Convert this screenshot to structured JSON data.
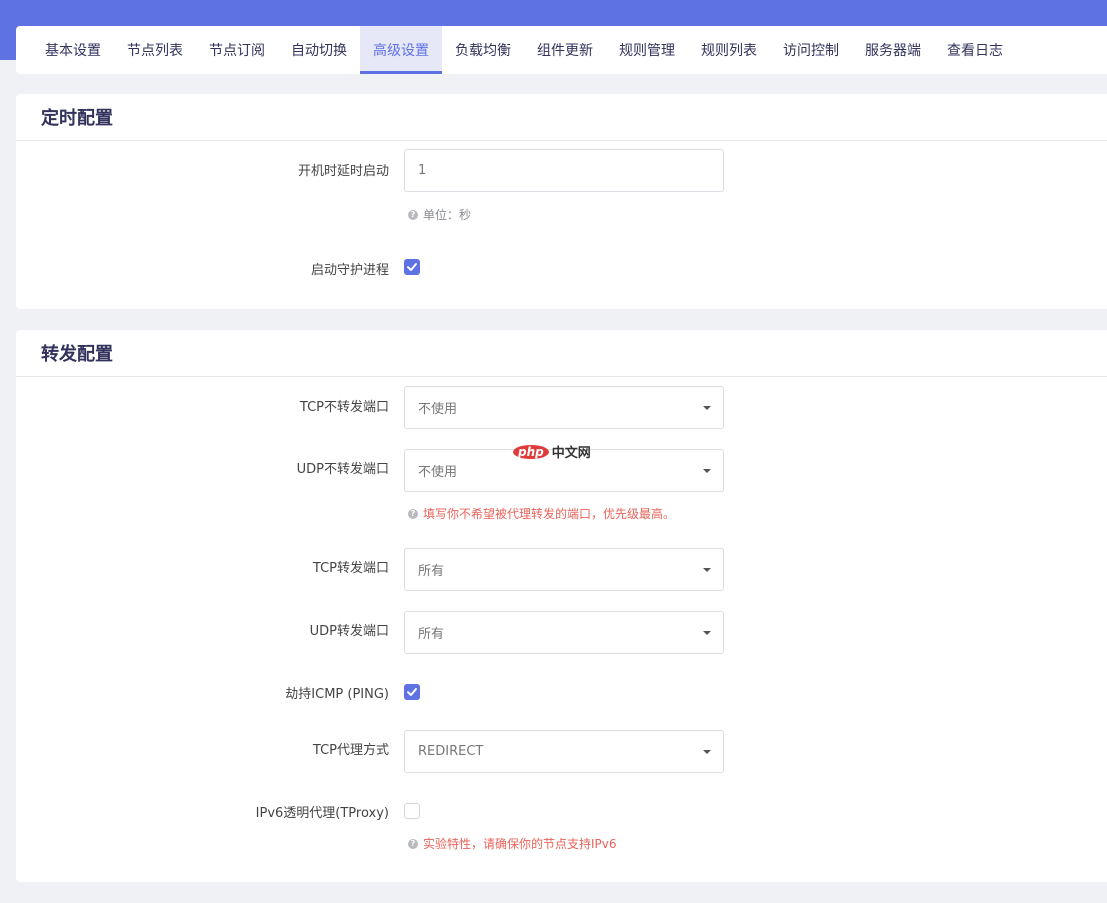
{
  "tabs": [
    {
      "label": "基本设置"
    },
    {
      "label": "节点列表"
    },
    {
      "label": "节点订阅"
    },
    {
      "label": "自动切换"
    },
    {
      "label": "高级设置",
      "active": true
    },
    {
      "label": "负载均衡"
    },
    {
      "label": "组件更新"
    },
    {
      "label": "规则管理"
    },
    {
      "label": "规则列表"
    },
    {
      "label": "访问控制"
    },
    {
      "label": "服务器端"
    },
    {
      "label": "查看日志"
    }
  ],
  "timer": {
    "title": "定时配置",
    "boot_delay": {
      "label": "开机时延时启动",
      "value": "1",
      "hint": "单位：秒"
    },
    "daemon": {
      "label": "启动守护进程",
      "checked": true
    }
  },
  "forward": {
    "title": "转发配置",
    "tcp_no_redir": {
      "label": "TCP不转发端口",
      "value": "不使用"
    },
    "udp_no_redir": {
      "label": "UDP不转发端口",
      "value": "不使用",
      "hint": "填写你不希望被代理转发的端口，优先级最高。"
    },
    "tcp_redir": {
      "label": "TCP转发端口",
      "value": "所有"
    },
    "udp_redir": {
      "label": "UDP转发端口",
      "value": "所有"
    },
    "hijack_icmp": {
      "label": "劫持ICMP (PING)",
      "checked": true
    },
    "tcp_proxy_way": {
      "label": "TCP代理方式",
      "value": "REDIRECT"
    },
    "ipv6_tproxy": {
      "label": "IPv6透明代理(TProxy)",
      "checked": false,
      "hint": "实验特性，请确保你的节点支持IPv6"
    }
  },
  "watermark": {
    "logo": "php",
    "text": "中文网"
  },
  "colors": {
    "accent": "#5e72e4",
    "hint_red": "#e8635a"
  }
}
